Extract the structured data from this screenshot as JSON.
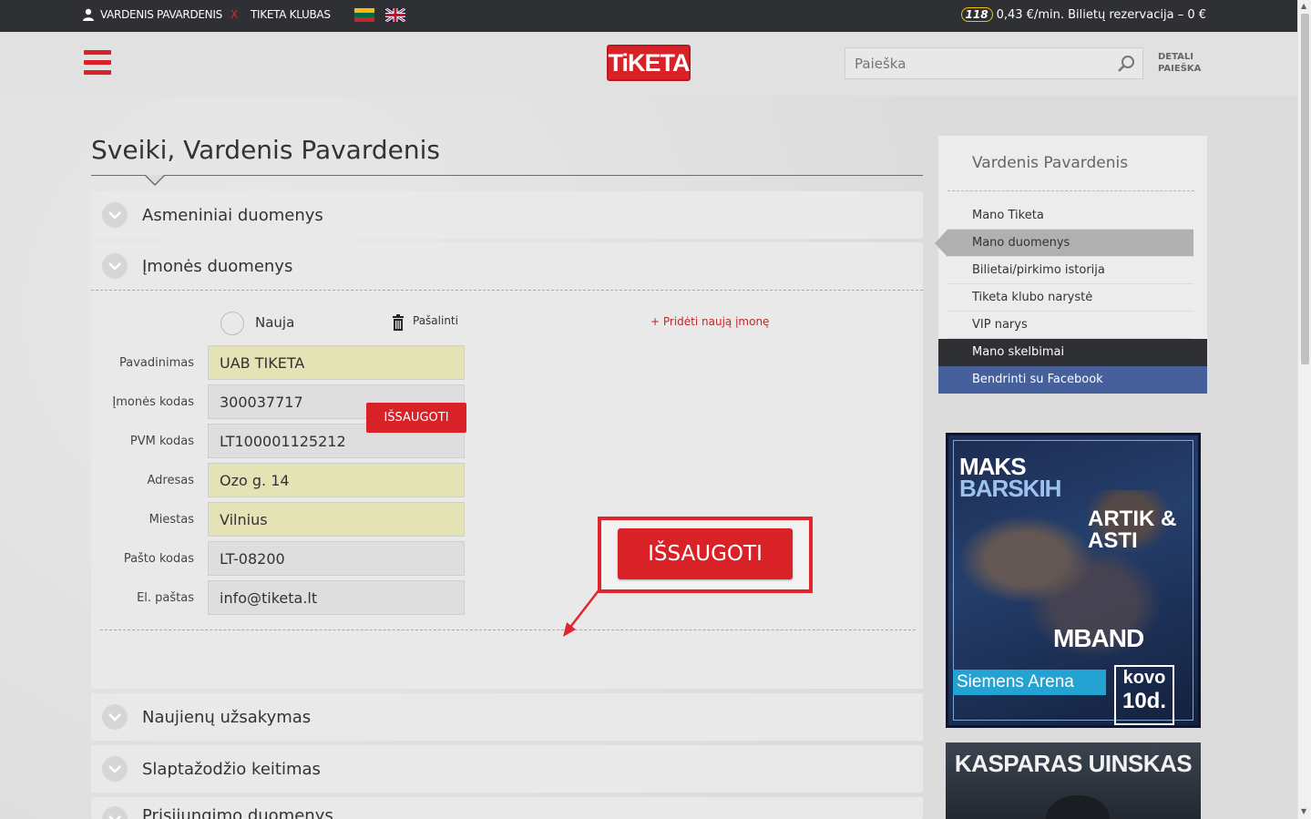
{
  "topbar": {
    "user_name": "VARDENIS PAVARDENIS",
    "logout_x": "X",
    "club": "TIKETA KLUBAS",
    "hotline_badge": "118",
    "promo": "0,43 €/min. Bilietų rezervacija – 0 €"
  },
  "header": {
    "logo": "TiKETA",
    "search_placeholder": "Paieška",
    "detailed_search_line1": "DETALI",
    "detailed_search_line2": "PAIEŠKA"
  },
  "main": {
    "title": "Sveiki, Vardenis Pavardenis",
    "sections": {
      "personal": "Asmeniniai duomenys",
      "company": "Įmonės duomenys",
      "newsletter": "Naujienų užsakymas",
      "password": "Slaptažodžio keitimas",
      "login": "Prisijungimo duomenys"
    },
    "company_form": {
      "new_label": "Nauja",
      "remove_label": "Pašalinti",
      "add_company": "+ Pridėti naują įmonę",
      "fields": [
        {
          "label": "Pavadinimas",
          "value": "UAB TIKETA",
          "required": true
        },
        {
          "label": "Įmonės kodas",
          "value": "300037717",
          "required": false
        },
        {
          "label": "PVM kodas",
          "value": "LT100001125212",
          "required": false
        },
        {
          "label": "Adresas",
          "value": "Ozo g. 14",
          "required": true
        },
        {
          "label": "Miestas",
          "value": "Vilnius",
          "required": true
        },
        {
          "label": "Pašto kodas",
          "value": "LT-08200",
          "required": false
        },
        {
          "label": "El. paštas",
          "value": "info@tiketa.lt",
          "required": false
        }
      ],
      "save_label": "IŠSAUGOTI",
      "callout_label": "IŠSAUGOTI"
    }
  },
  "sidebar": {
    "user_name": "Vardenis Pavardenis",
    "items": [
      {
        "label": "Mano Tiketa"
      },
      {
        "label": "Mano duomenys"
      },
      {
        "label": "Bilietai/pirkimo istorija"
      },
      {
        "label": "Tiketa klubo narystė"
      },
      {
        "label": "VIP narys"
      },
      {
        "label": "Mano skelbimai"
      },
      {
        "label": "Bendrinti su Facebook"
      }
    ]
  },
  "ads": {
    "ad1": {
      "artist1_line1": "MAKS",
      "artist1_line2": "BARSKIH",
      "artist2_line1": "ARTIK &",
      "artist2_line2": "ASTI",
      "artist3": "MBAND",
      "venue": "Siemens Arena",
      "date_line1": "kovo",
      "date_line2": "10d."
    },
    "ad2": {
      "title": "KASPARAS UINSKAS"
    }
  },
  "colors": {
    "brand_red": "#d92128",
    "topbar": "#2e3033",
    "facebook": "#46609b",
    "required_field": "#e3e3b5"
  }
}
